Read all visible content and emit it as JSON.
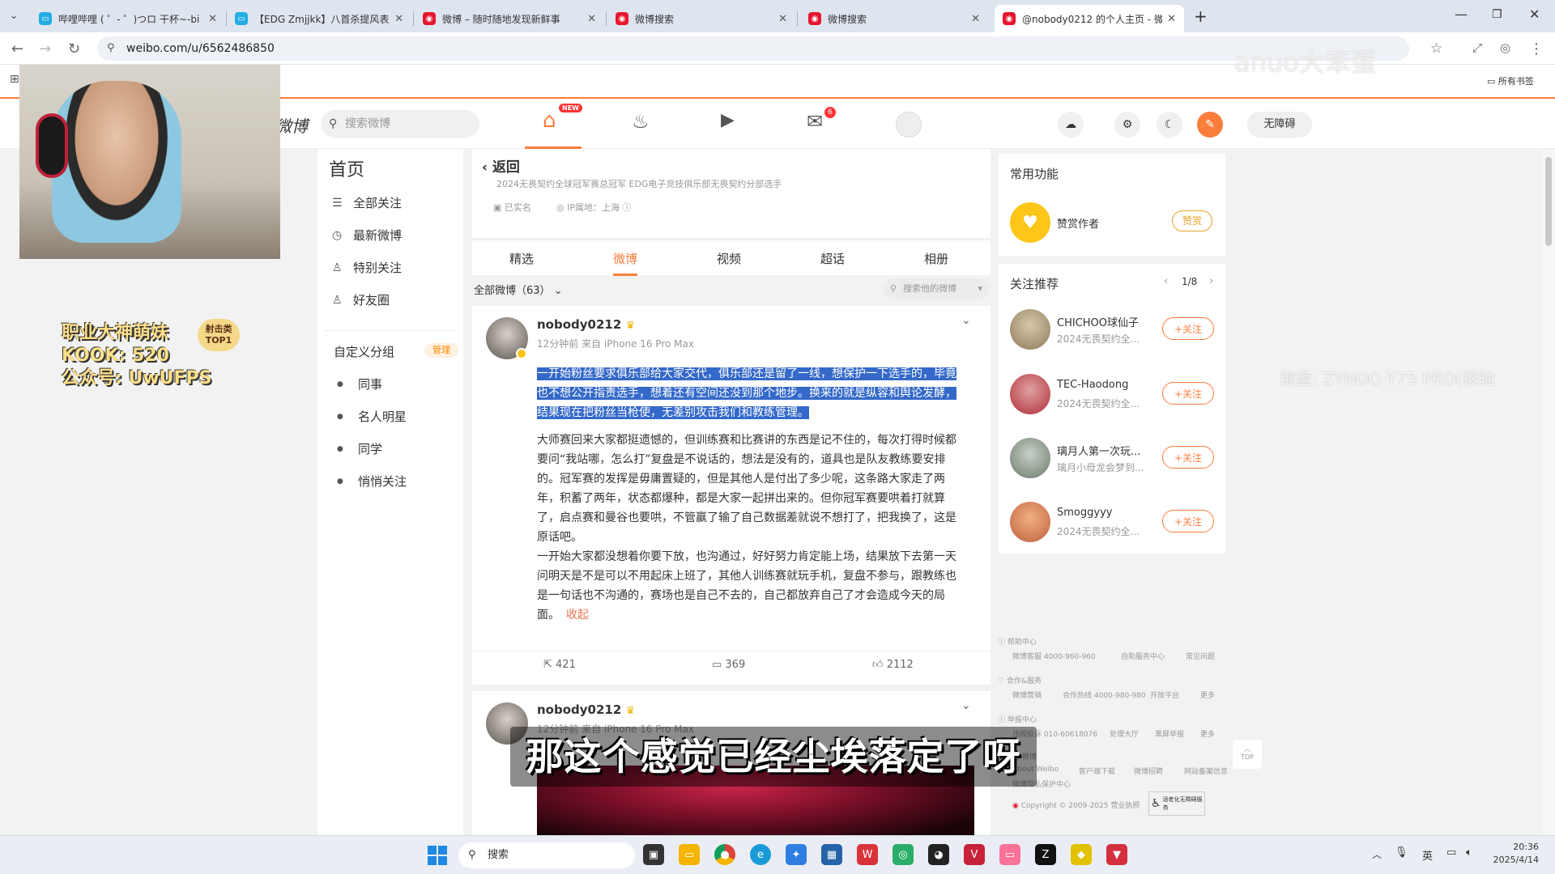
{
  "browser": {
    "tabs": [
      {
        "title": "哔哩哔哩 ( ゜- ゜)つロ 干杯~-bi",
        "color": "#23ade5",
        "glyph": "▭"
      },
      {
        "title": "【EDG Zmjjkk】八首杀提风表",
        "color": "#23ade5",
        "glyph": "▭"
      },
      {
        "title": "微博 – 随时随地发现新鲜事",
        "color": "#e6162d",
        "glyph": "◉"
      },
      {
        "title": "微博搜索",
        "color": "#e6162d",
        "glyph": "◉"
      },
      {
        "title": "微博搜索",
        "color": "#e6162d",
        "glyph": "◉"
      },
      {
        "title": "@nobody0212 的个人主页 - 微",
        "color": "#e6162d",
        "glyph": "◉"
      }
    ],
    "url": "weibo.com/u/6562486850",
    "bookmarks_label": "所有书签"
  },
  "header": {
    "search_placeholder": "搜索微博",
    "new_badge": "NEW",
    "mail_badge": "6",
    "accessibility_label": "无障碍"
  },
  "left_nav": {
    "home": "首页",
    "items": [
      "全部关注",
      "最新微博",
      "特别关注",
      "好友圈"
    ],
    "groups_title": "自定义分组",
    "manage": "管理",
    "groups": [
      "同事",
      "名人明星",
      "同学",
      "悄悄关注"
    ]
  },
  "profile": {
    "back": "返回",
    "bio_line": "2024无畏契约全球冠军赛总冠军 EDG电子竞技俱乐部无畏契约分部选手",
    "verified": "已实名",
    "ip_location": "IP属地：上海",
    "tabs": [
      "精选",
      "微博",
      "视频",
      "超话",
      "相册"
    ],
    "active_tab": "微博",
    "filter_label": "全部微博（63）",
    "search_posts": "搜索他的微博"
  },
  "post1": {
    "username": "nobody0212",
    "meta": "12分钟前 来自 iPhone 16 Pro Max",
    "highlighted": "一开始粉丝要求俱乐部给大家交代，俱乐部还是留了一线，想保护一下选手的，毕竟也不想公开指责选手，想着还有空间还没到那个地步。换来的就是纵容和舆论发酵，结果现在把粉丝当枪使，无差别攻击我们和教练管理。",
    "para2": "大师赛回来大家都挺遗憾的，但训练赛和比赛讲的东西是记不住的，每次打得时候都要问“我站哪，怎么打”复盘是不说话的，想法是没有的，道具也是队友教练要安排的。冠军赛的发挥是毋庸置疑的，但是其他人是付出了多少呢，这条路大家走了两年，积蓄了两年，状态都爆种，都是大家一起拼出来的。但你冠军赛要哄着打就算了，启点赛和曼谷也要哄，不管赢了输了自己数据差就说不想打了，把我换了，这是原话吧。",
    "para3": "一开始大家都没想着你要下放，也沟通过，好好努力肯定能上场，结果放下去第一天问明天是不是可以不用起床上班了，其他人训练赛就玩手机，复盘不参与，跟教练也是一句话也不沟通的，赛场也是自己不去的，自己都放弃自己了才会造成今天的局面。",
    "collapse": "收起",
    "reposts": "421",
    "comments": "369",
    "likes": "2112"
  },
  "post2": {
    "username": "nobody0212",
    "meta": "12分钟前 来自 iPhone 16 Pro Max"
  },
  "right": {
    "common_title": "常用功能",
    "tip_author": "赞赏作者",
    "tip_btn": "赞赏",
    "rec_title": "关注推荐",
    "rec_page": "1/8",
    "follow_label": "+关注",
    "recommendations": [
      {
        "name": "CHICHOO球仙子",
        "desc": "2024无畏契约全...",
        "color": "#8a7a5a"
      },
      {
        "name": "TEC-Haodong",
        "desc": "2024无畏契约全...",
        "color": "#b0303a"
      },
      {
        "name": "璃月人第一次玩...",
        "desc": "璃月小母龙会梦到...",
        "color": "#7a8a7a"
      },
      {
        "name": "Smoggyyy",
        "desc": "2024无畏契约全...",
        "color": "#c06040"
      }
    ],
    "footer": {
      "help": "帮助中心",
      "help_line": [
        "微博客服 4000-960-960",
        "自助服务中心",
        "常见问题"
      ],
      "coop": "合作&服务",
      "coop_line": [
        "微博营销",
        "合作热线 4000-980-980",
        "开放平台",
        "更多"
      ],
      "report": "举报中心",
      "report_line": [
        "违规投诉 010-60618076",
        "处理大厅",
        "黑屏举报",
        "更多"
      ],
      "about": "关于微博",
      "about_line": [
        "About Weibo",
        "客户端下载",
        "微博招聘",
        "网站备案信息"
      ],
      "privacy": "微博隐私保护中心",
      "copyright": "Copyright © 2009-2025 营业执照",
      "elder": "适老化无障碍服务",
      "top": "TOP"
    }
  },
  "overlay": {
    "stream_text_1": "职业大神萌妹",
    "stream_text_2": "KOOK: 520",
    "stream_text_3": "公众号: UwUFPS",
    "stream_badge": "射击类TOP1",
    "subtitle": "那这个感觉已经尘埃落定了呀",
    "watermark_right": "键盘: ZYNOO Y75 PRO(核轴",
    "watermark_top": "anuo大笨蛋"
  },
  "taskbar": {
    "search": "搜索",
    "time": "20:36",
    "date": "2025/4/14",
    "ime": "英"
  }
}
